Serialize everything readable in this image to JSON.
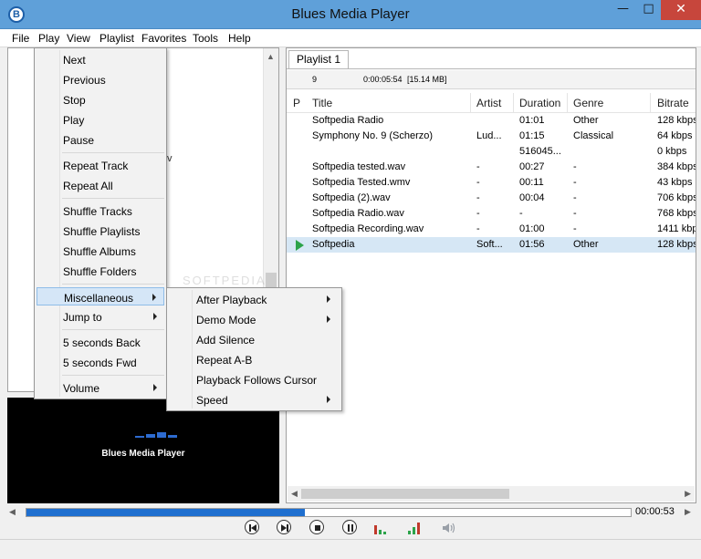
{
  "window": {
    "title": "Blues Media Player",
    "icon_letter": "B"
  },
  "menubar": [
    "File",
    "Play",
    "View",
    "Playlist",
    "Favorites",
    "Tools",
    "Help"
  ],
  "left_panel": {
    "partial_text": "v",
    "video_title": "Blues Media Player"
  },
  "playlist": {
    "tab": "Playlist 1",
    "count": "9",
    "total": "0:00:05:54",
    "size": "[15.14 MB]",
    "columns": [
      "P",
      "Title",
      "Artist",
      "Duration",
      "Genre",
      "Bitrate"
    ],
    "rows": [
      {
        "title": "Softpedia Radio",
        "artist": "",
        "duration": "01:01",
        "genre": "Other",
        "bitrate": "128 kbps"
      },
      {
        "title": "Symphony No. 9 (Scherzo)",
        "artist": "Lud...",
        "duration": "01:15",
        "genre": "Classical",
        "bitrate": "64 kbps"
      },
      {
        "title": "",
        "artist": "",
        "duration": "516045...",
        "genre": "",
        "bitrate": "0 kbps"
      },
      {
        "title": "Softpedia tested.wav",
        "artist": "-",
        "duration": "00:27",
        "genre": "-",
        "bitrate": "384 kbps"
      },
      {
        "title": "Softpedia Tested.wmv",
        "artist": "-",
        "duration": "00:11",
        "genre": "-",
        "bitrate": "43 kbps"
      },
      {
        "title": "Softpedia (2).wav",
        "artist": "-",
        "duration": "00:04",
        "genre": "-",
        "bitrate": "706 kbps"
      },
      {
        "title": "Softpedia Radio.wav",
        "artist": "-",
        "duration": "-",
        "genre": "-",
        "bitrate": "768 kbps"
      },
      {
        "title": "Softpedia Recording.wav",
        "artist": "-",
        "duration": "01:00",
        "genre": "-",
        "bitrate": "1411 kbps"
      },
      {
        "title": "Softpedia",
        "artist": "Soft...",
        "duration": "01:56",
        "genre": "Other",
        "bitrate": "128 kbps",
        "playing": true
      }
    ]
  },
  "play_menu": {
    "items": [
      "Next",
      "Previous",
      "Stop",
      "Play",
      "Pause",
      "Repeat Track",
      "Repeat All",
      "Shuffle Tracks",
      "Shuffle Playlists",
      "Shuffle Albums",
      "Shuffle Folders",
      "Miscellaneous",
      "Jump to",
      "5 seconds Back",
      "5 seconds Fwd",
      "Volume"
    ]
  },
  "misc_submenu": {
    "items": [
      "After Playback",
      "Demo Mode",
      "Add Silence",
      "Repeat A-B",
      "Playback Follows Cursor",
      "Speed"
    ]
  },
  "transport": {
    "time": "00:00:53",
    "progress_pct": 46
  },
  "watermark": "SOFTPEDIA",
  "colors": {
    "titlebar": "#5fa0d9",
    "accent": "#1f6fcf",
    "selected_row": "#d6e7f5",
    "play_indicator": "#2ca34a"
  }
}
